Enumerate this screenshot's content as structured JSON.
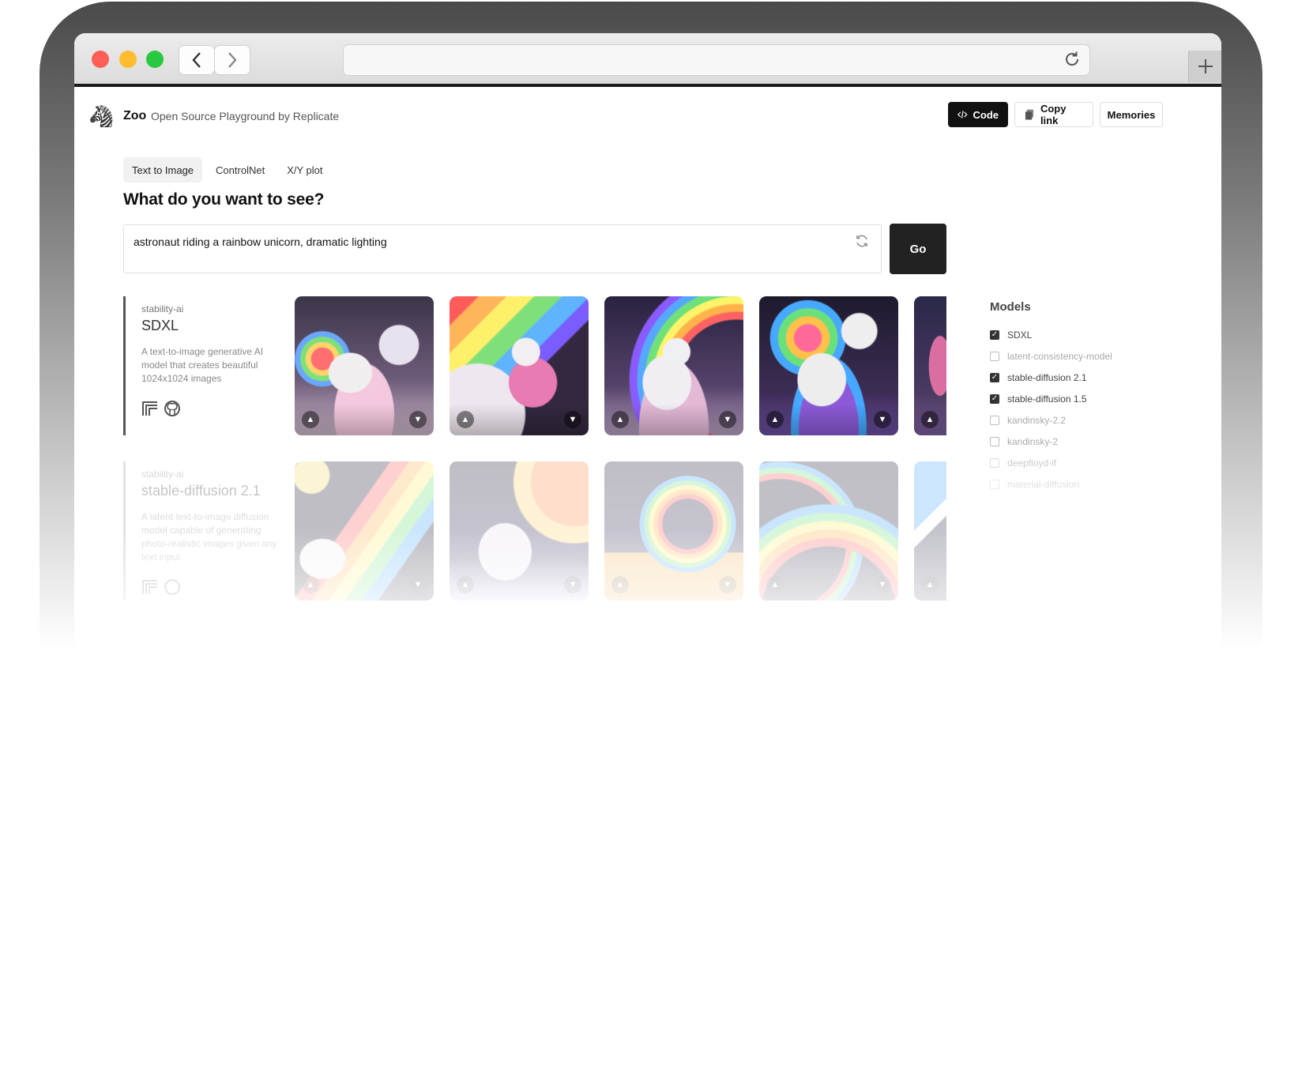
{
  "header": {
    "logo_emoji": "🦓",
    "brand": "Zoo",
    "tagline": "Open Source Playground by Replicate",
    "code_label": "Code",
    "copy_link_label": "Copy link",
    "memories_label": "Memories"
  },
  "tabs": [
    {
      "label": "Text to Image",
      "active": true
    },
    {
      "label": "ControlNet",
      "active": false
    },
    {
      "label": "X/Y plot",
      "active": false
    }
  ],
  "question": "What do you want to see?",
  "prompt": {
    "value": "astronaut riding a rainbow unicorn, dramatic lighting"
  },
  "go_label": "Go",
  "results": [
    {
      "owner": "stability-ai",
      "name": "SDXL",
      "description": "A text-to-image generative AI model that creates beautiful 1024x1024 images"
    },
    {
      "owner": "stability-ai",
      "name": "stable-diffusion 2.1",
      "description": "A latent text-to-image diffusion model capable of generating photo-realistic images given any text input"
    }
  ],
  "sidebar": {
    "title": "Models",
    "models": [
      {
        "label": "SDXL",
        "checked": true
      },
      {
        "label": "latent-consistency-model",
        "checked": false
      },
      {
        "label": "stable-diffusion 2.1",
        "checked": true
      },
      {
        "label": "stable-diffusion 1.5",
        "checked": true
      },
      {
        "label": "kandinsky-2.2",
        "checked": false
      },
      {
        "label": "kandinsky-2",
        "checked": false
      },
      {
        "label": "deepfloyd-if",
        "checked": false
      },
      {
        "label": "material-diffusion",
        "checked": false
      }
    ]
  },
  "colors": {
    "primary_button": "#111111",
    "go_button": "#222222",
    "traffic_red": "#fe5f57",
    "traffic_yellow": "#febc2e",
    "traffic_green": "#28c840"
  }
}
